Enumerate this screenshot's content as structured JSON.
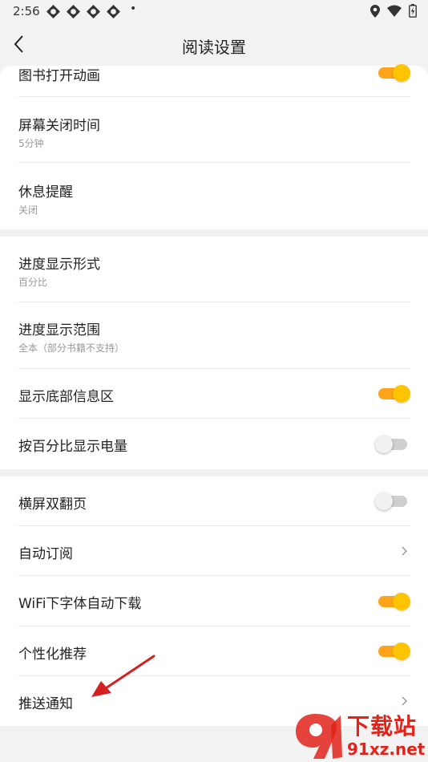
{
  "status_bar": {
    "time": "2:56",
    "dot": "•",
    "app_icons": [
      "app-notification-icon",
      "app-notification-icon",
      "app-notification-icon",
      "app-notification-icon"
    ],
    "right_icons": [
      "location-icon",
      "wifi-icon",
      "battery-charging-icon"
    ]
  },
  "header": {
    "title": "阅读设置",
    "back_icon": "back-arrow-icon"
  },
  "sections": [
    {
      "items": [
        {
          "title": "图书打开动画",
          "control": "toggle",
          "on": true
        },
        {
          "title": "屏幕关闭时间",
          "subtitle": "5分钟"
        },
        {
          "title": "休息提醒",
          "subtitle": "关闭"
        }
      ]
    },
    {
      "items": [
        {
          "title": "进度显示形式",
          "subtitle": "百分比"
        },
        {
          "title": "进度显示范围",
          "subtitle": "全本（部分书籍不支持）"
        },
        {
          "title": "显示底部信息区",
          "control": "toggle",
          "on": true
        },
        {
          "title": "按百分比显示电量",
          "control": "toggle",
          "on": false
        }
      ]
    },
    {
      "items": [
        {
          "title": "横屏双翻页",
          "control": "toggle",
          "on": false
        },
        {
          "title": "自动订阅",
          "control": "chevron"
        },
        {
          "title": "WiFi下字体自动下载",
          "control": "toggle",
          "on": true
        },
        {
          "title": "个性化推荐",
          "control": "toggle",
          "on": true
        },
        {
          "title": "推送通知",
          "control": "chevron"
        }
      ]
    }
  ],
  "annotation": {
    "type": "red-arrow",
    "points_to": "推送通知"
  },
  "watermark": {
    "title": "下载站",
    "url": "91xz.net",
    "color": "#e2231a"
  },
  "colors": {
    "accent": "#ffc400",
    "accent_track": "#ffa31a",
    "background": "#f2f2f2"
  }
}
